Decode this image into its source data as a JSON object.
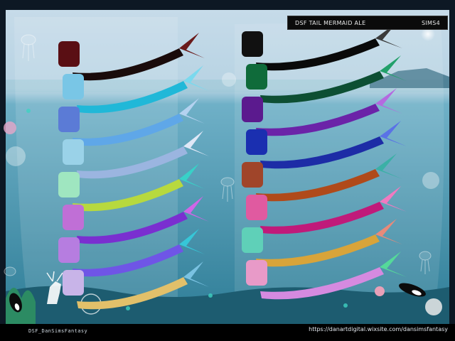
{
  "header": {
    "title": "DSF TAIL MERMAID ALE",
    "game": "SIMS4"
  },
  "footer": {
    "credit": "DSF_DanSimsFantasy",
    "url": "https://danartdigital.wixsite.com/dansimsfantasy"
  },
  "swatches": {
    "left_column": [
      {
        "top": "#5a0f14",
        "tail": "#1a0b0b",
        "tail_accent": "#6a1a1a"
      },
      {
        "top": "#79c6e6",
        "tail": "#20b8d8",
        "tail_accent": "#7ad9ee"
      },
      {
        "top": "#5b7bd6",
        "tail": "#5fa7e8",
        "tail_accent": "#b4d2f0"
      },
      {
        "top": "#9ad2e8",
        "tail": "#9bb5e0",
        "tail_accent": "#dfe8f7"
      },
      {
        "top": "#9fe6c0",
        "tail": "#b7d93e",
        "tail_accent": "#38d1c8"
      },
      {
        "top": "#c06fd6",
        "tail": "#7a2fd0",
        "tail_accent": "#d065e8"
      },
      {
        "top": "#b67de0",
        "tail": "#6f55e6",
        "tail_accent": "#36c7d8"
      },
      {
        "top": "#c8b4e8",
        "tail": "#e2c06a",
        "tail_accent": "#7ac2e2"
      }
    ],
    "right_column": [
      {
        "top": "#111111",
        "tail": "#0a0a0a",
        "tail_accent": "#3a3a3a"
      },
      {
        "top": "#0f6b3a",
        "tail": "#0d4f33",
        "tail_accent": "#22a06a"
      },
      {
        "top": "#5b1a8e",
        "tail": "#6b23a8",
        "tail_accent": "#b46ae0"
      },
      {
        "top": "#1a2fb0",
        "tail": "#1d2ca6",
        "tail_accent": "#5a72e6"
      },
      {
        "top": "#a0452a",
        "tail": "#b04a1a",
        "tail_accent": "#3bb0a6"
      },
      {
        "top": "#e05aa0",
        "tail": "#c01a7a",
        "tail_accent": "#f07ac0"
      },
      {
        "top": "#5fd0b8",
        "tail": "#d8a43a",
        "tail_accent": "#e88a7a"
      },
      {
        "top": "#e89ac8",
        "tail": "#d58ae0",
        "tail_accent": "#55d99a"
      }
    ]
  },
  "colors": {
    "sky_top": "#c8dcea",
    "sky_bottom": "#7fb7cf",
    "sea_top": "#4f9fb7",
    "sea_bottom": "#2f7e97",
    "panel_bg": "#0b0b0b",
    "frame": "#0e1722"
  }
}
